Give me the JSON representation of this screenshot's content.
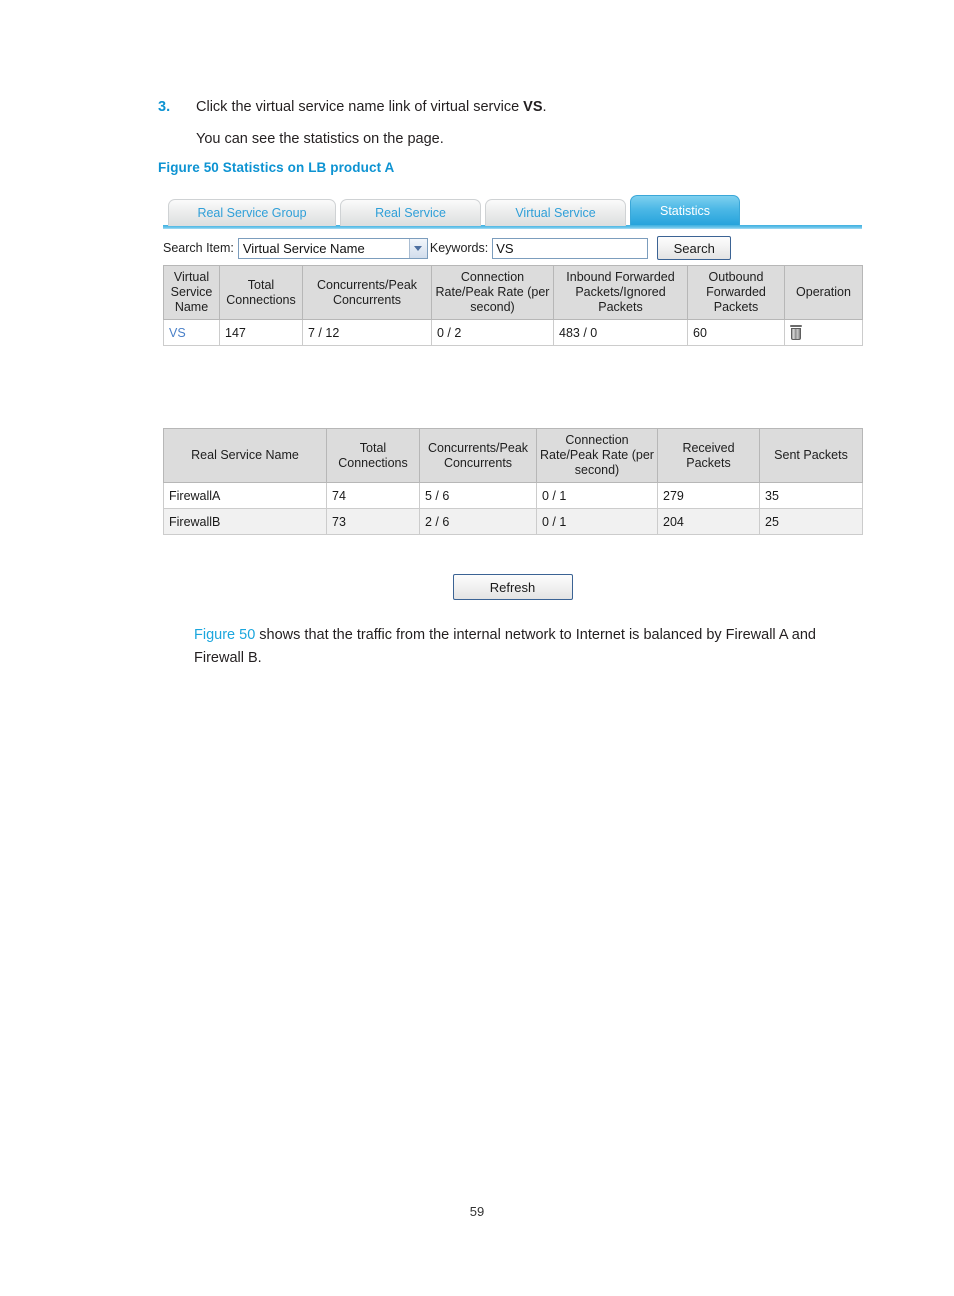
{
  "step": {
    "number": "3.",
    "text_before": "Click the virtual service name link of virtual service ",
    "text_bold": "VS",
    "text_after": ".",
    "subtext": "You can see the statistics on the page."
  },
  "figure_caption": "Figure 50 Statistics on LB product A",
  "ui": {
    "tabs": [
      {
        "label": "Real Service Group",
        "active": false
      },
      {
        "label": "Real Service",
        "active": false
      },
      {
        "label": "Virtual Service",
        "active": false
      },
      {
        "label": "Statistics",
        "active": true
      }
    ],
    "search": {
      "item_label": "Search Item:",
      "item_value": "Virtual Service Name",
      "keywords_label": "Keywords:",
      "keywords_value": "VS",
      "keywords_placeholder": "",
      "search_button": "Search"
    },
    "virtual_service_table": {
      "headers": [
        "Virtual Service Name",
        "Total Connections",
        "Concurrents/Peak Concurrents",
        "Connection Rate/Peak Rate (per second)",
        "Inbound Forwarded Packets/Ignored Packets",
        "Outbound Forwarded Packets",
        "Operation"
      ],
      "rows": [
        {
          "name": "VS",
          "total_connections": "147",
          "concurrents_peak": "7 / 12",
          "conn_rate_peak": "0 / 2",
          "inbound_fwd_ignored": "483 / 0",
          "outbound_fwd": "60",
          "operation_icon": "delete-icon"
        }
      ]
    },
    "real_service_table": {
      "headers": [
        "Real Service Name",
        "Total Connections",
        "Concurrents/Peak Concurrents",
        "Connection Rate/Peak Rate (per second)",
        "Received Packets",
        "Sent Packets"
      ],
      "rows": [
        {
          "name": "FirewallA",
          "total_connections": "74",
          "concurrents_peak": "5 / 6",
          "conn_rate_peak": "0 / 1",
          "received_packets": "279",
          "sent_packets": "35"
        },
        {
          "name": "FirewallB",
          "total_connections": "73",
          "concurrents_peak": "2 / 6",
          "conn_rate_peak": "0 / 1",
          "received_packets": "204",
          "sent_packets": "25"
        }
      ]
    },
    "refresh_button": "Refresh"
  },
  "post_paragraph": {
    "link": "Figure 50",
    "rest": " shows that the traffic from the internal network to Internet is balanced by Firewall A and Firewall B."
  },
  "page_number": "59",
  "colors": {
    "accent_blue": "#0d93d2",
    "tab_active_blue": "#26a3dc",
    "tab_text_blue": "#2f9fd8",
    "link_blue": "#4a80c8",
    "header_gray": "#dcdcdc"
  }
}
